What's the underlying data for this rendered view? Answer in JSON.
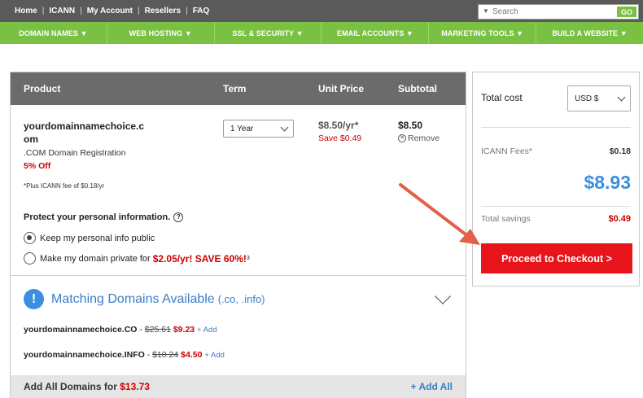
{
  "topbar": {
    "links": [
      "Home",
      "ICANN",
      "My Account",
      "Resellers",
      "FAQ"
    ],
    "search_placeholder": "Search",
    "search_button": "GO"
  },
  "nav": {
    "items": [
      "DOMAIN NAMES ▼",
      "WEB HOSTING ▼",
      "SSL & SECURITY ▼",
      "EMAIL ACCOUNTS ▼",
      "MARKETING TOOLS ▼",
      "BUILD A WEBSITE ▼"
    ]
  },
  "cart": {
    "headers": {
      "product": "Product",
      "term": "Term",
      "unit_price": "Unit Price",
      "subtotal": "Subtotal"
    },
    "item": {
      "name": "yourdomainnamechoice.com",
      "description": ".COM Domain Registration",
      "discount": "5% Off",
      "fee_note": "*Plus ICANN fee of $0.18/yr",
      "term": "1 Year",
      "unit_price": "$8.50/yr*",
      "save": "Save $0.49",
      "subtotal": "$8.50",
      "remove": "Remove"
    },
    "privacy": {
      "heading": "Protect your personal information.",
      "option_public": "Keep my personal info public",
      "option_private_prefix": "Make my domain private for",
      "option_private_price": "$2.05/yr! SAVE 60%!",
      "option_private_sup": "3",
      "selected": "public"
    },
    "matching": {
      "title": "Matching Domains Available",
      "subtitle": "(.co, .info)",
      "domains": [
        {
          "name": "yourdomainnamechoice.CO",
          "old_price": "$25.61",
          "new_price": "$9.23",
          "add": "+ Add"
        },
        {
          "name": "yourdomainnamechoice.INFO",
          "old_price": "$10.24",
          "new_price": "$4.50",
          "add": "+ Add"
        }
      ],
      "add_all_label": "Add All Domains for",
      "add_all_price": "$13.73",
      "add_all_button": "+ Add All"
    }
  },
  "summary": {
    "total_label": "Total cost",
    "currency": "USD $",
    "icann_label": "ICANN Fees*",
    "icann_value": "$0.18",
    "total": "$8.93",
    "savings_label": "Total savings",
    "savings_value": "$0.49",
    "checkout": "Proceed to Checkout >"
  },
  "colors": {
    "nav_green": "#7ac143",
    "checkout_red": "#e8141b",
    "accent_blue": "#3a8fe0",
    "price_red": "#cc0000"
  }
}
